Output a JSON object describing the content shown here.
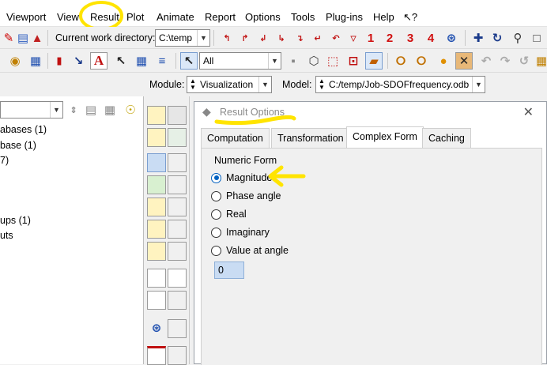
{
  "menu": [
    "Viewport",
    "View",
    "Result",
    "Plot",
    "Animate",
    "Report",
    "Options",
    "Tools",
    "Plug-ins",
    "Help",
    "↖?"
  ],
  "toolbar1": {
    "cwd_label": "Current work directory:",
    "cwd_value": "C:\\temp",
    "view_numbers": [
      "1",
      "2",
      "3",
      "4"
    ]
  },
  "toolbar2": {
    "selection_filter": "All",
    "text_tool": "A"
  },
  "toolbar3": {
    "module_label": "Module:",
    "module_value": "Visualization",
    "model_label": "Model:",
    "model_value": "C:/temp/Job-SDOFfrequency.odb"
  },
  "tree": {
    "items": [
      "abases (1)",
      "base (1)",
      "7)",
      "ups (1)",
      "uts"
    ]
  },
  "dialog": {
    "title": "Result Options",
    "tabs": [
      "Computation",
      "Transformation",
      "Complex Form",
      "Caching"
    ],
    "active_tab": "Complex Form",
    "group_label": "Numeric Form",
    "options": [
      "Magnitude",
      "Phase angle",
      "Real",
      "Imaginary",
      "Value at angle"
    ],
    "selected_option": "Magnitude",
    "angle_value": "0",
    "close": "✕"
  },
  "colors": {
    "highlight": "#ffe400",
    "accent_red": "#d01010",
    "accent_blue": "#0060c0"
  }
}
